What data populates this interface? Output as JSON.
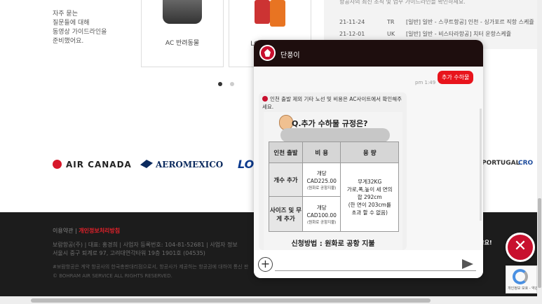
{
  "faq": {
    "lines": [
      "자주 묻는",
      "질문들에 대해",
      "동영상 가이드라인을",
      "준비했어요."
    ]
  },
  "cards": [
    {
      "caption": "AC 반려동물",
      "icon": "pet-carrier-icon"
    },
    {
      "caption": "LC 초과수하물",
      "icon": "luggage-icon"
    }
  ],
  "carousel": {
    "dots": 2,
    "active": 0
  },
  "notice": {
    "header": "항공사의 최신 조직 및 업무 가이드라인을 확인하세요.",
    "rows": [
      {
        "date": "21-11-24",
        "code": "TR",
        "title": "[일반] 일반 - 스쿠트항공] 인천 - 싱가포르 직항 스케쥴"
      },
      {
        "date": "21-12-01",
        "code": "UK",
        "title": "[일반] 일반 - 비스타라항공] 치터 운항스케쥴"
      }
    ]
  },
  "partners": {
    "aircanada": "AIR CANADA",
    "aeromexico": "AEROMEXICO",
    "lot": "LO",
    "portugal": "PORTUGAL",
    "crc": "CRO"
  },
  "footer": {
    "link1": "이용약관",
    "sep": "|",
    "link2": "개인정보처리방침",
    "info1": "보람항공(주) | 대표: 홍경희 | 사업자 등록번호: 104-81-52681 | 사업자 정보",
    "info2": "서울시 중구 퇴계로 97, 고려대연각타워 19층 1901호 (04535)",
    "small1": "#보람항공은 계약 항공사의 한국총판대리점으로서, 항공사가 제공하는 항공권에 대하여 통신 판",
    "copyright": "© BOHRAM AIR SERVICE ALL RIGHTS RESERVED."
  },
  "chat": {
    "title": "단풍이",
    "user_msg": "추가 수하물",
    "timestamp": "pm 1:49",
    "bot_text": "인천 출발 제외 기타 노선 및 비용은 AC사이트에서 확인해주세요.",
    "card_title": "Q.추가 수하물 규정은?",
    "table": {
      "headers": [
        "인천 출발",
        "비 용",
        "용 량"
      ],
      "rows": [
        {
          "label": "개수 추가",
          "fee_top": "개당",
          "fee": "CAD225.00",
          "fee_note": "(원화로 공항지불)"
        },
        {
          "label": "사이즈 및 무게 추가",
          "fee_top": "개당",
          "fee": "CAD100.00",
          "fee_note": "(원화로 공항지불)"
        }
      ],
      "capacity": [
        "무게32KG",
        "가로,폭,높이 세 면의",
        "합 292cm",
        "(한 면이 203cm를",
        "초과 할 수 없음)"
      ]
    },
    "method": "신청방법 : 원화로 공항 지불",
    "badge_text": "!요!"
  },
  "close_glyph": "✕",
  "recaptcha_text": "개인정보 보호 - 약관",
  "colors": {
    "brand_red": "#c8102e",
    "chat_header": "#1e0e0e",
    "footer_bg": "#1c1c1c"
  }
}
